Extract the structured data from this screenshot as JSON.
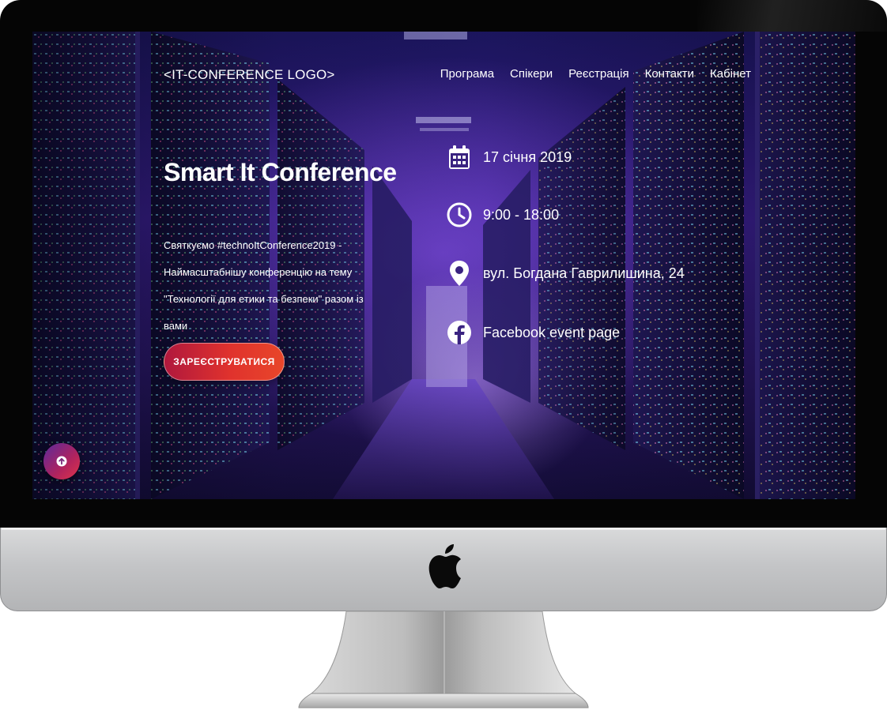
{
  "site": {
    "logo": "<IT-CONFERENCE LOGO>",
    "nav": [
      "Програма",
      "Спікери",
      "Реєстрація",
      "Контакти",
      "Кабінет"
    ]
  },
  "hero": {
    "title": "Smart It Conference",
    "description_lines": [
      "Святкуємо #technoItConference2019 -",
      "Наймасштабнішу конференцію на тему",
      "\"Технології для етики та безпеки\" разом із",
      "вами"
    ],
    "register_button": "ЗАРЕЄСТРУВАТИСЯ"
  },
  "details": {
    "date": "17 січня 2019",
    "time": "9:00 - 18:00",
    "address": "вул. Богдана Гаврилишина, 24",
    "facebook": "Facebook event page"
  },
  "icons": {
    "date": "calendar-icon",
    "time": "clock-icon",
    "address": "map-pin-icon",
    "facebook": "facebook-icon",
    "scroll": "arrow-up-icon",
    "brand": "apple-logo"
  },
  "colors": {
    "accent_start": "#b0183d",
    "accent_end": "#e8462a",
    "scene_purple": "#3a1f8c",
    "text": "#ffffff"
  }
}
